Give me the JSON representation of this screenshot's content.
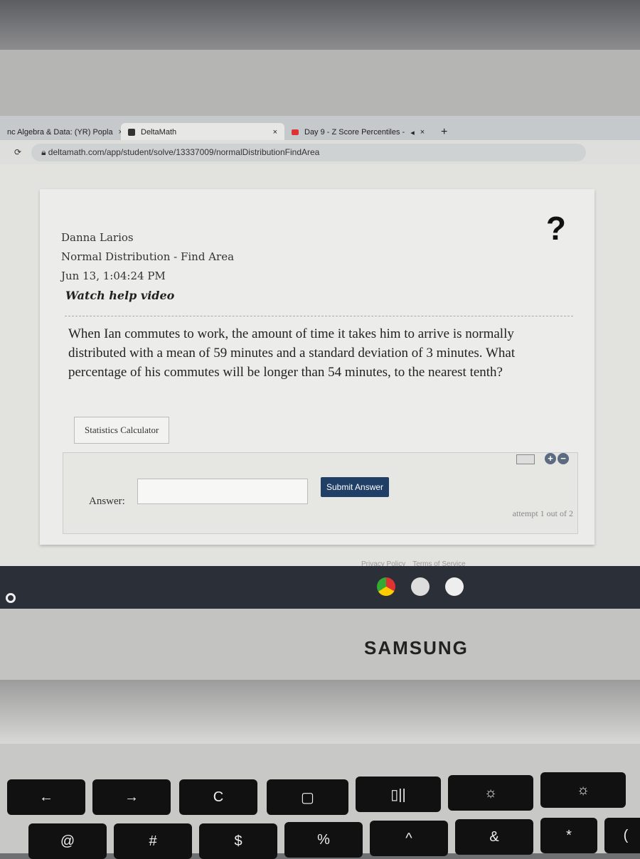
{
  "browser": {
    "tabs": [
      {
        "label": "nc Algebra & Data: (YR) Popla",
        "active": false
      },
      {
        "label": "DeltaMath",
        "active": true
      },
      {
        "label": "Day 9 - Z Score Percentiles -",
        "active": false
      }
    ],
    "new_tab": "+",
    "close": "×",
    "url": "deltamath.com/app/student/solve/13337009/normalDistributionFindArea"
  },
  "page": {
    "student": "Danna Larios",
    "assignment": "Normal Distribution - Find Area",
    "datetime": "Jun 13, 1:04:24 PM",
    "help_link": "Watch help video",
    "help_icon": "?",
    "question": "When Ian commutes to work, the amount of time it takes him to arrive is normally distributed with a mean of 59 minutes and a standard deviation of 3 minutes. What percentage of his commutes will be longer than 54 minutes, to the nearest tenth?",
    "calculator_button": "Statistics Calculator",
    "answer_label": "Answer:",
    "answer_value": "",
    "submit_button": "Submit Answer",
    "attempt": "attempt 1 out of 2",
    "footer": [
      "Privacy Policy",
      "Terms of Service"
    ]
  },
  "device": {
    "brand": "SAMSUNG"
  },
  "keys": [
    "←",
    "→",
    "C",
    "▢",
    "▯||",
    "☼",
    "☼",
    "@",
    "#",
    "$",
    "%",
    "^",
    "&",
    "*",
    "("
  ],
  "colors": {
    "submit": "#1f3f66",
    "shelf": "#2a2f38"
  }
}
